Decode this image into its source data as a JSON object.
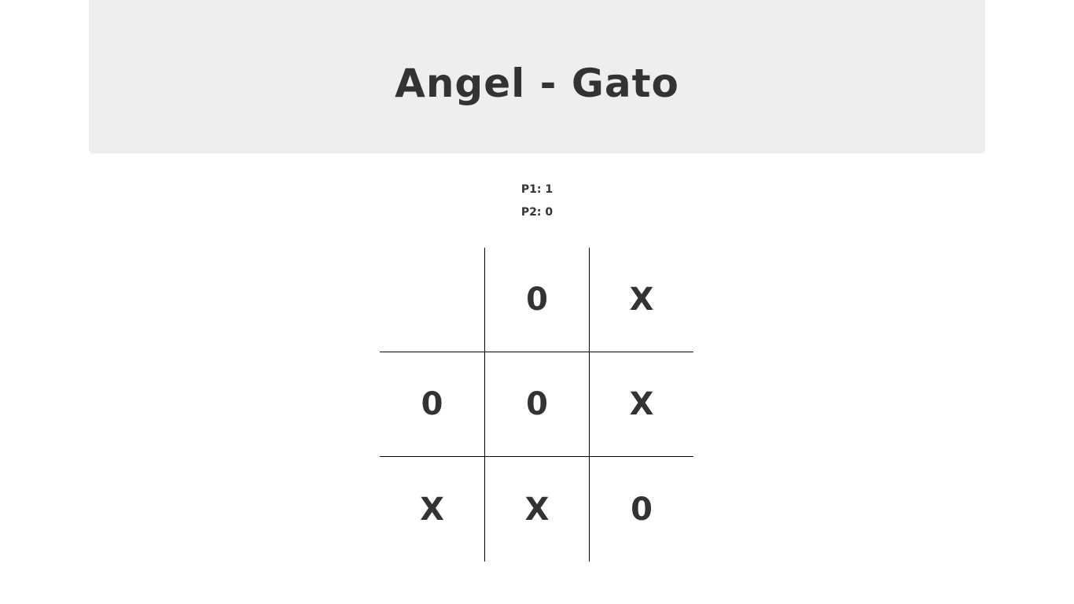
{
  "header": {
    "title": "Angel - Gato"
  },
  "scores": {
    "p1": "P1: 1",
    "p2": "P2: 0"
  },
  "board": {
    "cells": [
      "",
      "0",
      "X",
      "0",
      "0",
      "X",
      "X",
      "X",
      "0"
    ]
  },
  "colors": {
    "header_bg": "#eeeeee",
    "text": "#333333",
    "grid_lines": "#000000"
  }
}
